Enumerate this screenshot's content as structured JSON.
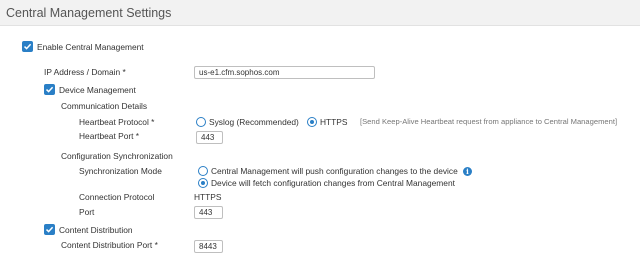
{
  "header": {
    "title": "Central Management Settings"
  },
  "enable_central_management": {
    "label": "Enable Central Management",
    "checked": true
  },
  "ip_address": {
    "label": "IP Address / Domain",
    "required_mark": "*",
    "value": "us-e1.cfm.sophos.com"
  },
  "device_management": {
    "label": "Device Management",
    "checked": true,
    "communication_details": {
      "title": "Communication Details",
      "heartbeat_protocol": {
        "label": "Heartbeat Protocol",
        "required_mark": "*",
        "options": [
          "Syslog (Recommended)",
          "HTTPS"
        ],
        "selected": "HTTPS",
        "hint": "[Send Keep-Alive Heartbeat request from appliance to Central Management]"
      },
      "heartbeat_port": {
        "label": "Heartbeat Port",
        "required_mark": "*",
        "value": "443"
      }
    },
    "configuration_sync": {
      "title": "Configuration Synchronization",
      "sync_mode": {
        "label": "Synchronization Mode",
        "options": [
          "Central Management will push configuration changes to the device",
          "Device will fetch configuration changes from Central Management"
        ],
        "selected": "Device will fetch configuration changes from Central Management"
      },
      "connection_protocol": {
        "label": "Connection Protocol",
        "value": "HTTPS"
      },
      "port": {
        "label": "Port",
        "value": "443"
      }
    }
  },
  "content_distribution": {
    "label": "Content Distribution",
    "checked": true,
    "port": {
      "label": "Content Distribution Port",
      "required_mark": "*",
      "value": "8443"
    }
  },
  "colors": {
    "accent": "#2a7fc6"
  }
}
